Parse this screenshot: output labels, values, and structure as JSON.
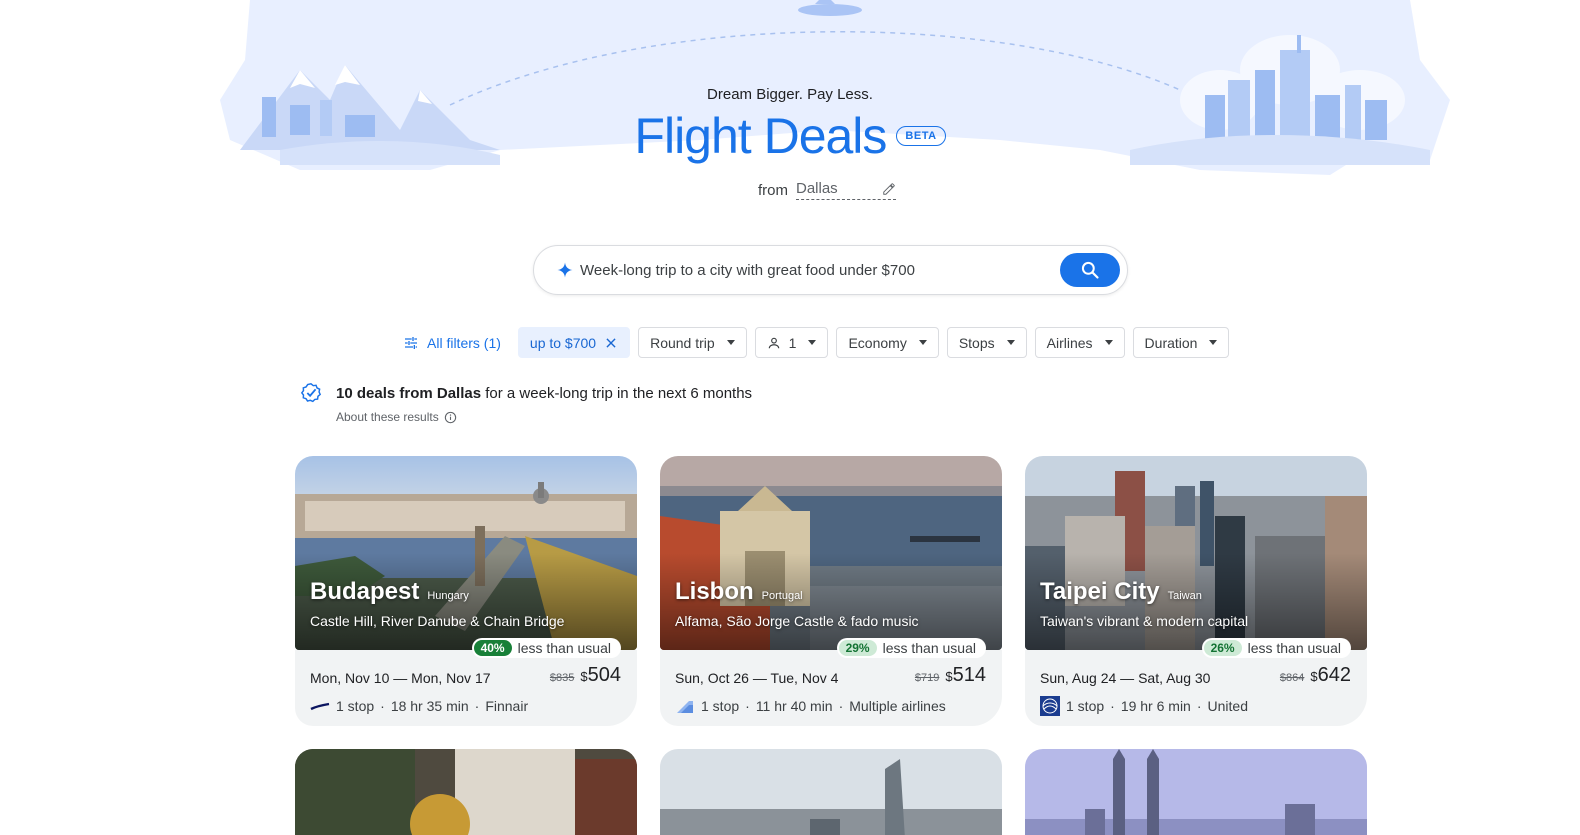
{
  "header": {
    "tagline": "Dream Bigger. Pay Less.",
    "title": "Flight Deals",
    "badge": "BETA",
    "from_label": "from",
    "from_city": "Dallas"
  },
  "search": {
    "query": "Week-long trip to a city with great food under $700"
  },
  "filters": {
    "all_filters": "All filters (1)",
    "price": "up to $700",
    "trip_type": "Round trip",
    "passengers": "1",
    "cabin": "Economy",
    "stops": "Stops",
    "airlines": "Airlines",
    "duration": "Duration"
  },
  "summary": {
    "count_from": "10 deals from Dallas",
    "rest": "for a week-long trip in the next 6 months",
    "about": "About these results"
  },
  "deals": [
    {
      "city": "Budapest",
      "country": "Hungary",
      "description": "Castle Hill, River Danube & Chain Bridge",
      "discount": "40%",
      "discount_text": "less than usual",
      "dates": "Mon, Nov 10 — Mon, Nov 17",
      "old_price": "$835",
      "price_symbol": "$",
      "price": "504",
      "stops": "1 stop",
      "duration": "18 hr 35 min",
      "airline": "Finnair",
      "airline_icon": "finnair-logo-icon"
    },
    {
      "city": "Lisbon",
      "country": "Portugal",
      "description": "Alfama, São Jorge Castle & fado music",
      "discount": "29%",
      "discount_text": "less than usual",
      "dates": "Sun, Oct 26 — Tue, Nov 4",
      "old_price": "$719",
      "price_symbol": "$",
      "price": "514",
      "stops": "1 stop",
      "duration": "11 hr 40 min",
      "airline": "Multiple airlines",
      "airline_icon": "multiple-airlines-icon"
    },
    {
      "city": "Taipei City",
      "country": "Taiwan",
      "description": "Taiwan's vibrant & modern capital",
      "discount": "26%",
      "discount_text": "less than usual",
      "dates": "Sun, Aug 24 — Sat, Aug 30",
      "old_price": "$864",
      "price_symbol": "$",
      "price": "642",
      "stops": "1 stop",
      "duration": "19 hr 6 min",
      "airline": "United",
      "airline_icon": "united-logo-icon"
    }
  ],
  "separator": "·",
  "colors": {
    "accent": "#1a73e8",
    "discount_strong": "#188038",
    "discount_light": "#ceead6",
    "card_body": "#f1f3f4"
  }
}
